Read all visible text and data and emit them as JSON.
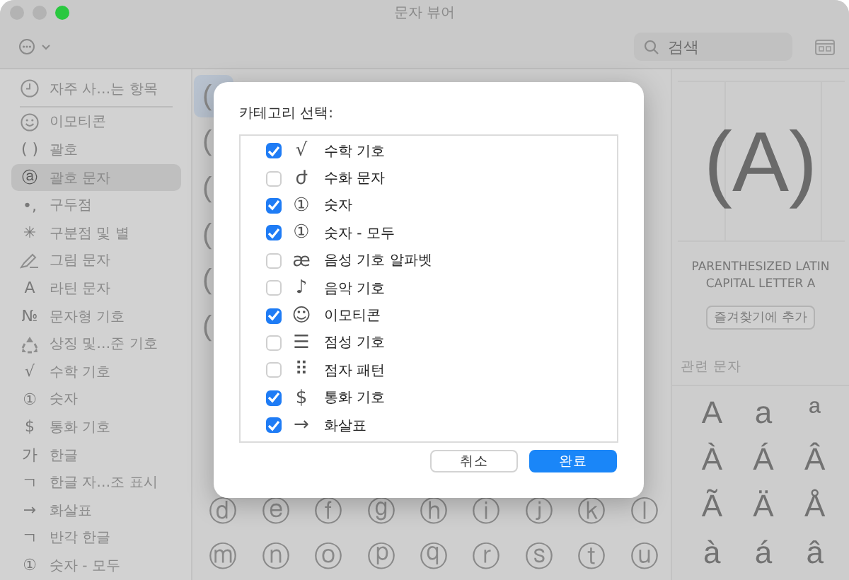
{
  "window": {
    "title": "문자 뷰어"
  },
  "toolbar": {
    "search": {
      "placeholder": "검색"
    }
  },
  "sidebar": {
    "recent": {
      "label": "자주 사…는 항목",
      "selected": false
    },
    "items": [
      {
        "label": "이모티콘",
        "kind": "smiley",
        "selected": false
      },
      {
        "label": "괄호",
        "glyph": "( )",
        "selected": false
      },
      {
        "label": "괄호 문자",
        "glyph": "ⓐ",
        "selected": true
      },
      {
        "label": "구두점",
        "glyph": "•,",
        "selected": false
      },
      {
        "label": "구분점 및 별",
        "glyph": "✳",
        "selected": false
      },
      {
        "label": "그림 문자",
        "kind": "pen",
        "selected": false
      },
      {
        "label": "라틴 문자",
        "glyph": "A",
        "selected": false
      },
      {
        "label": "문자형 기호",
        "glyph": "№",
        "selected": false
      },
      {
        "label": "상징 및…준 기호",
        "kind": "recycle",
        "selected": false
      },
      {
        "label": "수학 기호",
        "glyph": "√",
        "selected": false
      },
      {
        "label": "숫자",
        "glyph": "①",
        "selected": false
      },
      {
        "label": "통화 기호",
        "glyph": "$",
        "selected": false
      },
      {
        "label": "한글",
        "glyph": "가",
        "selected": false
      },
      {
        "label": "한글 자…조 표시",
        "glyph": "ㄱ",
        "selected": false
      },
      {
        "label": "화살표",
        "glyph": "→",
        "selected": false
      },
      {
        "label": "반각 한글",
        "glyph": "ㄱ",
        "selected": false
      },
      {
        "label": "숫자 - 모두",
        "glyph": "①",
        "selected": false
      }
    ]
  },
  "grid": {
    "top_rows": [
      [
        {
          "char": "(",
          "selected": true
        }
      ],
      [
        {
          "char": "(",
          "selected": false
        }
      ],
      [
        {
          "char": "(",
          "selected": false
        }
      ],
      [
        {
          "char": "(",
          "selected": false
        }
      ],
      [
        {
          "char": "(",
          "selected": false
        }
      ],
      [
        {
          "char": "(",
          "selected": false
        }
      ]
    ],
    "bottom_rows": [
      [
        {
          "char": "ⓓ",
          "selected": false
        },
        {
          "char": "ⓔ",
          "selected": false
        },
        {
          "char": "ⓕ",
          "selected": false
        },
        {
          "char": "ⓖ",
          "selected": false
        },
        {
          "char": "ⓗ",
          "selected": false
        },
        {
          "char": "ⓘ",
          "selected": false
        },
        {
          "char": "ⓙ",
          "selected": false
        },
        {
          "char": "ⓚ",
          "selected": false
        },
        {
          "char": "ⓛ",
          "selected": false
        }
      ],
      [
        {
          "char": "ⓜ",
          "selected": false
        },
        {
          "char": "ⓝ",
          "selected": false
        },
        {
          "char": "ⓞ",
          "selected": false
        },
        {
          "char": "ⓟ",
          "selected": false
        },
        {
          "char": "ⓠ",
          "selected": false
        },
        {
          "char": "ⓡ",
          "selected": false
        },
        {
          "char": "ⓢ",
          "selected": false
        },
        {
          "char": "ⓣ",
          "selected": false
        },
        {
          "char": "ⓤ",
          "selected": false
        }
      ]
    ]
  },
  "detail": {
    "preview": "(A)",
    "name": "PARENTHESIZED LATIN CAPITAL LETTER A",
    "favorite_button": "즐겨찾기에 추가",
    "related_heading": "관련 문자",
    "related": [
      "A",
      "a",
      "ª",
      "À",
      "Á",
      "Â",
      "Ã",
      "Ä",
      "Å",
      "à",
      "á",
      "â"
    ]
  },
  "dialog": {
    "heading": "카테고리 선택:",
    "categories": [
      {
        "glyph": "√",
        "label": "수학 기호",
        "checked": true
      },
      {
        "glyph": "ժ",
        "label": "수화 문자",
        "checked": false
      },
      {
        "glyph": "①",
        "label": "숫자",
        "checked": true
      },
      {
        "glyph": "①",
        "label": "숫자 - 모두",
        "checked": true
      },
      {
        "glyph": "æ",
        "label": "음성 기호 알파벳",
        "checked": false
      },
      {
        "glyph": "♪",
        "label": "음악 기호",
        "checked": false
      },
      {
        "glyph": "☺",
        "label": "이모티콘",
        "checked": true
      },
      {
        "glyph": "☰",
        "label": "점성 기호",
        "checked": false
      },
      {
        "glyph": "⠿",
        "label": "점자 패턴",
        "checked": false
      },
      {
        "glyph": "$",
        "label": "통화 기호",
        "checked": true
      },
      {
        "glyph": "→",
        "label": "화살표",
        "checked": true
      }
    ],
    "cancel": "취소",
    "done": "완료"
  }
}
